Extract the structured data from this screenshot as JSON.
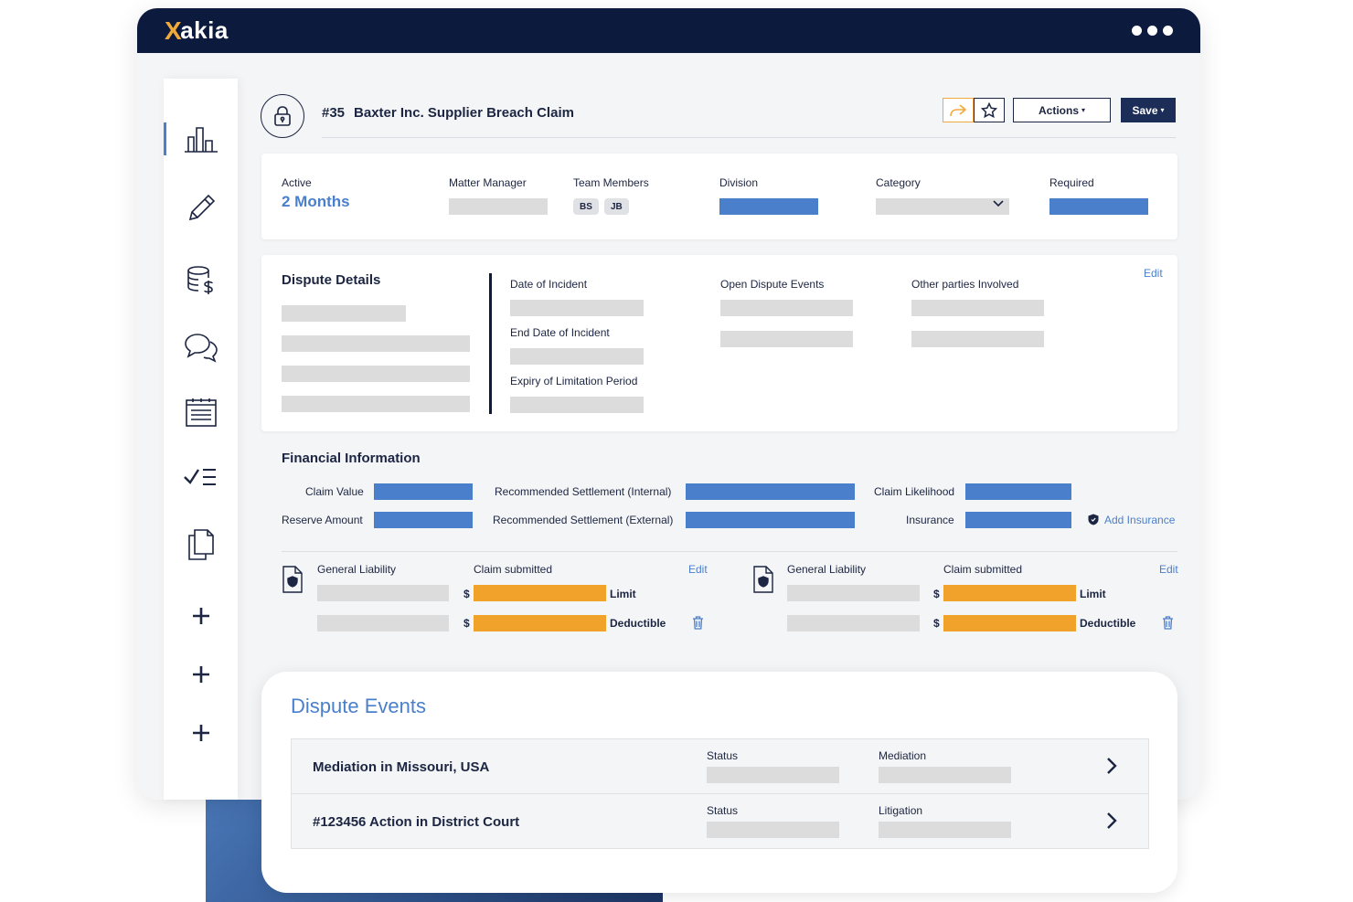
{
  "app": {
    "logo_mark": "X",
    "logo_text": "akia"
  },
  "colors": {
    "navy": "#0c1a3d",
    "accent_blue": "#4a7fcb",
    "accent_orange": "#f0a22a"
  },
  "sidebar": {
    "items": [
      {
        "icon": "bar-chart-icon"
      },
      {
        "icon": "pencil-icon"
      },
      {
        "icon": "database-dollar-icon"
      },
      {
        "icon": "chat-bubbles-icon"
      },
      {
        "icon": "calendar-list-icon"
      },
      {
        "icon": "checklist-icon"
      },
      {
        "icon": "documents-icon"
      },
      {
        "icon": "plus-icon"
      },
      {
        "icon": "plus-icon"
      },
      {
        "icon": "plus-icon"
      }
    ]
  },
  "header": {
    "number": "#35",
    "title": "Baxter Inc. Supplier Breach Claim",
    "actions_label": "Actions",
    "save_label": "Save"
  },
  "summary": {
    "active_label": "Active",
    "active_value": "2 Months",
    "matter_manager_label": "Matter Manager",
    "team_members_label": "Team Members",
    "team_members": [
      "BS",
      "JB"
    ],
    "division_label": "Division",
    "category_label": "Category",
    "required_label": "Required"
  },
  "dispute_details": {
    "title": "Dispute Details",
    "edit_label": "Edit",
    "date_of_incident_label": "Date of Incident",
    "end_date_label": "End Date of Incident",
    "expiry_label": "Expiry of Limitation Period",
    "open_events_label": "Open Dispute Events",
    "other_parties_label": "Other parties Involved"
  },
  "financial": {
    "title": "Financial Information",
    "claim_value_label": "Claim Value",
    "reserve_amount_label": "Reserve Amount",
    "rec_internal_label": "Recommended Settlement (Internal)",
    "rec_external_label": "Recommended Settlement (External)",
    "claim_likelihood_label": "Claim Likelihood",
    "insurance_label": "Insurance",
    "add_insurance_label": "Add Insurance"
  },
  "insurance_policies": [
    {
      "type_label": "General Liability",
      "claim_label": "Claim submitted",
      "edit_label": "Edit",
      "currency": "$",
      "limit_label": "Limit",
      "deductible_label": "Deductible"
    },
    {
      "type_label": "General Liability",
      "claim_label": "Claim submitted",
      "edit_label": "Edit",
      "currency": "$",
      "limit_label": "Limit",
      "deductible_label": "Deductible"
    }
  ],
  "dispute_events": {
    "title": "Dispute Events",
    "rows": [
      {
        "name": "Mediation in Missouri, USA",
        "status_label": "Status",
        "type_label": "Mediation"
      },
      {
        "name": "#123456 Action in District Court",
        "status_label": "Status",
        "type_label": "Litigation"
      }
    ]
  }
}
